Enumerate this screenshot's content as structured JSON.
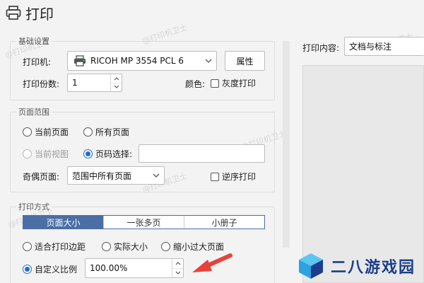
{
  "window": {
    "title": "打印"
  },
  "basic": {
    "legend": "基础设置",
    "printer_label": "打印机:",
    "printer_value": "RICOH MP 3554 PCL 6",
    "properties_button": "属性",
    "copies_label": "打印份数:",
    "copies_value": "1",
    "color_label": "颜色:",
    "grayscale_label": "灰度打印"
  },
  "page_range": {
    "legend": "页面范围",
    "current_page": "当前页面",
    "all_pages": "所有页面",
    "current_view": "当前视图",
    "page_select": "页码选择:",
    "page_select_value": "",
    "odd_even_label": "奇偶页面:",
    "odd_even_value": "范围中所有页面",
    "reverse_label": "逆序打印"
  },
  "print_mode": {
    "legend": "打印方式",
    "tabs": [
      "页面大小",
      "一张多页",
      "小册子"
    ],
    "active_tab": 0,
    "fit_margins": "适合打印边距",
    "actual_size": "实际大小",
    "shrink_large": "缩小过大页面",
    "custom_scale": "自定义比例",
    "scale_value": "100.00%"
  },
  "right": {
    "content_label": "打印内容:",
    "content_value": "文档与标注"
  },
  "watermark": "@打印机卫士",
  "logo": {
    "text": "二八游戏园",
    "colors": [
      "#2aa3e0",
      "#1b3d8a",
      "#5cc6f2"
    ]
  },
  "colors": {
    "accent": "#1f6fd1",
    "tab_active": "#4a6ea5",
    "arrow": "#e8423b"
  }
}
